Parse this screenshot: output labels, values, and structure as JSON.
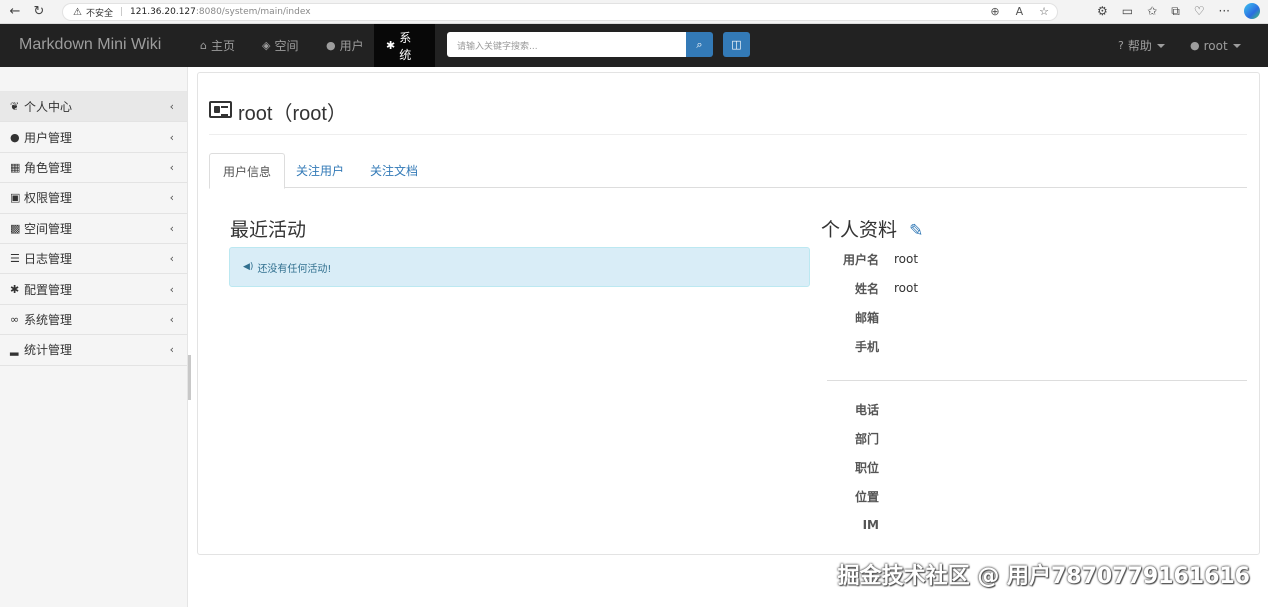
{
  "browser": {
    "insecure_label": "不安全",
    "url_host": "121.36.20.127",
    "url_rest": ":8080/system/main/index"
  },
  "navbar": {
    "brand": "Markdown Mini Wiki",
    "items": [
      {
        "label": "主页",
        "icon": "home-icon"
      },
      {
        "label": "空间",
        "icon": "cube-icon"
      },
      {
        "label": "用户",
        "icon": "user-icon"
      },
      {
        "label": "系统",
        "icon": "gear-icon"
      }
    ],
    "search_placeholder": "请输入关键字搜索...",
    "help_label": "帮助",
    "user_label": "root"
  },
  "sidebar": {
    "items": [
      {
        "label": "个人中心",
        "icon": "leaf-icon"
      },
      {
        "label": "用户管理",
        "icon": "user-icon"
      },
      {
        "label": "角色管理",
        "icon": "grid-icon"
      },
      {
        "label": "权限管理",
        "icon": "lock-icon"
      },
      {
        "label": "空间管理",
        "icon": "th-large-icon"
      },
      {
        "label": "日志管理",
        "icon": "list-icon"
      },
      {
        "label": "配置管理",
        "icon": "gear-icon"
      },
      {
        "label": "系统管理",
        "icon": "link-icon"
      },
      {
        "label": "统计管理",
        "icon": "signal-icon"
      }
    ]
  },
  "page": {
    "title": "root（root）",
    "tabs": [
      "用户信息",
      "关注用户",
      "关注文档"
    ],
    "activity_title": "最近活动",
    "activity_empty": "还没有任何活动!",
    "profile_title": "个人资料",
    "profile_rows_a": [
      {
        "label": "用户名",
        "value": "root"
      },
      {
        "label": "姓名",
        "value": "root"
      },
      {
        "label": "邮箱",
        "value": ""
      },
      {
        "label": "手机",
        "value": ""
      }
    ],
    "profile_rows_b": [
      {
        "label": "电话",
        "value": ""
      },
      {
        "label": "部门",
        "value": ""
      },
      {
        "label": "职位",
        "value": ""
      },
      {
        "label": "位置",
        "value": ""
      },
      {
        "label": "IM",
        "value": ""
      }
    ]
  },
  "watermark": "掘金技术社区 @ 用户7870779161616"
}
